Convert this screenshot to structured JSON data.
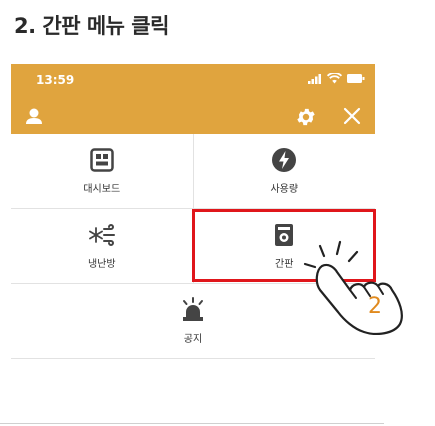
{
  "instruction": {
    "title": "2. 간판 메뉴 클릭"
  },
  "status_bar": {
    "time": "13:59"
  },
  "menu": {
    "items": [
      {
        "label": "대시보드",
        "icon": "dashboard-icon"
      },
      {
        "label": "사용량",
        "icon": "lightning-icon"
      },
      {
        "label": "냉난방",
        "icon": "snowflake-wind-icon"
      },
      {
        "label": "간판",
        "icon": "signboard-icon"
      },
      {
        "label": "공지",
        "icon": "alarm-bell-icon"
      }
    ]
  },
  "callout": {
    "step_number": "2",
    "color": "#e08a1e"
  },
  "colors": {
    "accent": "#e0a43e",
    "highlight": "#e0161b",
    "icon": "#444444"
  }
}
